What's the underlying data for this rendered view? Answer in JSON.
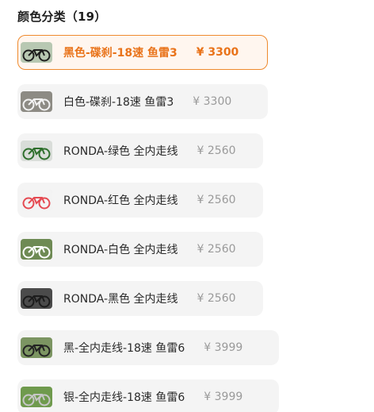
{
  "section": {
    "title": "颜色分类（19）"
  },
  "options": [
    {
      "name": "黑色-碟刹-18速 鱼雷3",
      "price": "¥ 3300",
      "selected": true,
      "thumb": {
        "frame": "#1f1f1f",
        "bg": "#b8c8b2"
      }
    },
    {
      "name": "白色-碟刹-18速 鱼雷3",
      "price": "¥ 3300",
      "selected": false,
      "thumb": {
        "frame": "#f2f2f2",
        "bg": "#8d8b84"
      }
    },
    {
      "name": "RONDA-绿色 全内走线",
      "price": "¥ 2560",
      "selected": false,
      "thumb": {
        "frame": "#2e6f2c",
        "bg": "#d9ddd9"
      }
    },
    {
      "name": "RONDA-红色 全内走线",
      "price": "¥ 2560",
      "selected": false,
      "thumb": {
        "frame": "#e54a52",
        "bg": "#f3f3f3"
      }
    },
    {
      "name": "RONDA-白色 全内走线",
      "price": "¥ 2560",
      "selected": false,
      "thumb": {
        "frame": "#ffffff",
        "bg": "#6e8a54"
      }
    },
    {
      "name": "RONDA-黑色 全内走线",
      "price": "¥ 2560",
      "selected": false,
      "thumb": {
        "frame": "#1c1c1c",
        "bg": "#4b4b4b"
      }
    },
    {
      "name": "黑-全内走线-18速 鱼雷6",
      "price": "¥ 3999",
      "selected": false,
      "thumb": {
        "frame": "#232323",
        "bg": "#7c9562"
      }
    },
    {
      "name": "银-全内走线-18速 鱼雷6",
      "price": "¥ 3999",
      "selected": false,
      "thumb": {
        "frame": "#c6c6c6",
        "bg": "#6f9a4d"
      }
    }
  ]
}
